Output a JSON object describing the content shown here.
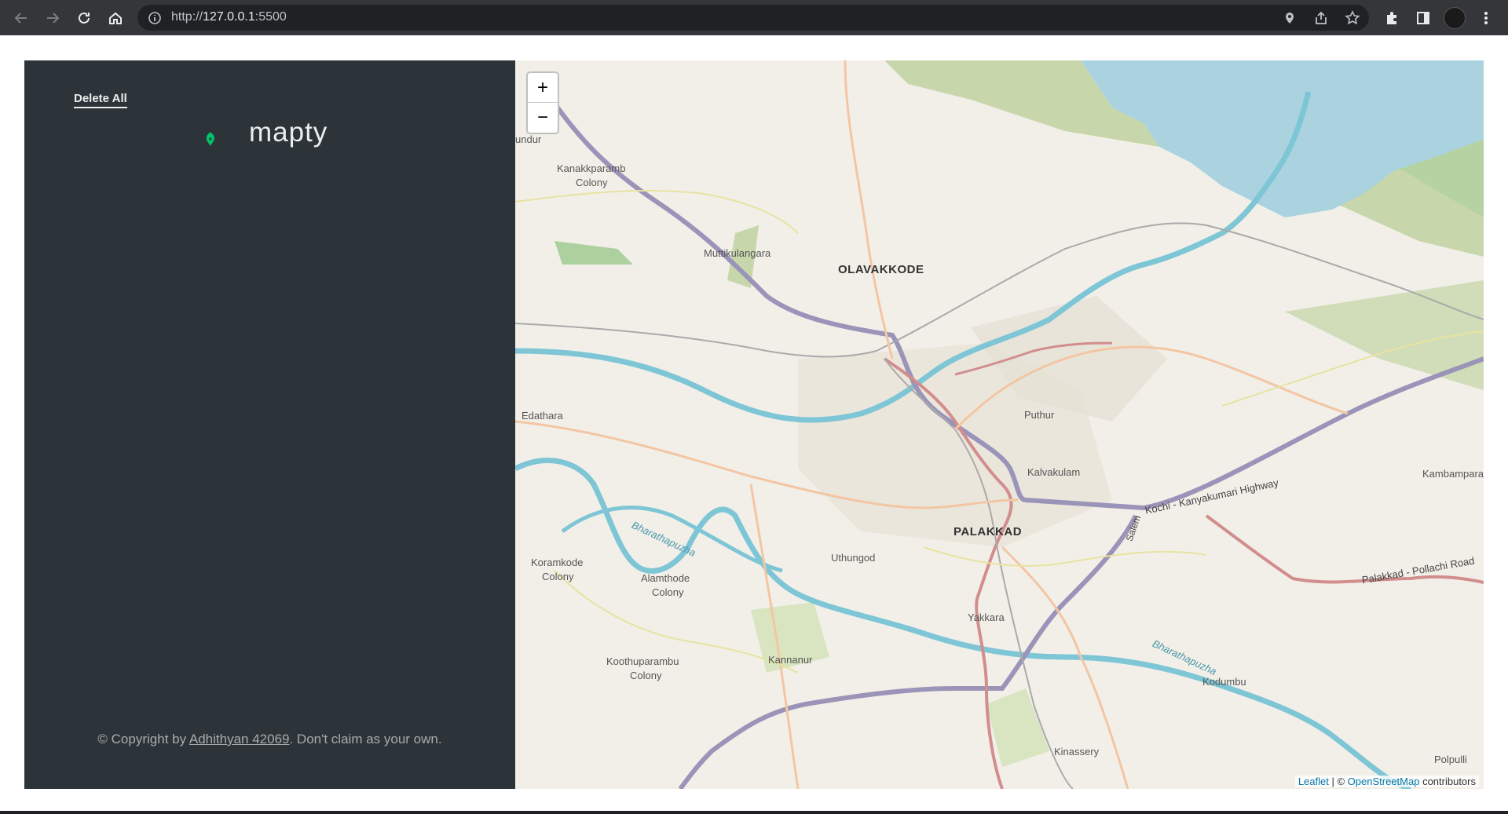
{
  "browser": {
    "url_prefix": "http://",
    "url_host": "127.0.0.1",
    "url_suffix": ":5500"
  },
  "sidebar": {
    "delete_all_label": "Delete All",
    "logo_text": "mapty",
    "copyright_prefix": "© Copyright by ",
    "copyright_link": "Adhithyan 42069",
    "copyright_suffix": ". Don't claim as your own."
  },
  "map": {
    "zoom_in": "+",
    "zoom_out": "−",
    "attribution_leaflet": "Leaflet",
    "attribution_sep": " | © ",
    "attribution_osm": "OpenStreetMap",
    "attribution_suffix": " contributors",
    "places": {
      "olavakkode": "OLAVAKKODE",
      "palakkad": "PALAKKAD",
      "kanakkparamb": "Kanakkparamb",
      "kanakkparamb2": "Colony",
      "muttikulangara": "Muttikulangara",
      "puthur": "Puthur",
      "kalvakulam": "Kalvakulam",
      "kambampara": "Kambampara",
      "edathara": "Edathara",
      "uthungod": "Uthungod",
      "koramkode": "Koramkode",
      "koramkode2": "Colony",
      "alamthode": "Alamthode",
      "alamthode2": "Colony",
      "yakkara": "Yakkara",
      "koothuparambu": "Koothuparambu",
      "koothuparambu2": "Colony",
      "kannanur": "Kannanur",
      "kodumbu": "Kodumbu",
      "kinassery": "Kinassery",
      "polpulli": "Polpulli",
      "unduru": "undur",
      "bharathapuzha1": "Bharathapuzha",
      "bharathapuzha2": "Bharathapuzha",
      "kochi_highway": "Kochi - Kanyakumari Highway",
      "salem": "Salem",
      "pollachi_road": "Palakkad - Pollachi Road"
    }
  }
}
